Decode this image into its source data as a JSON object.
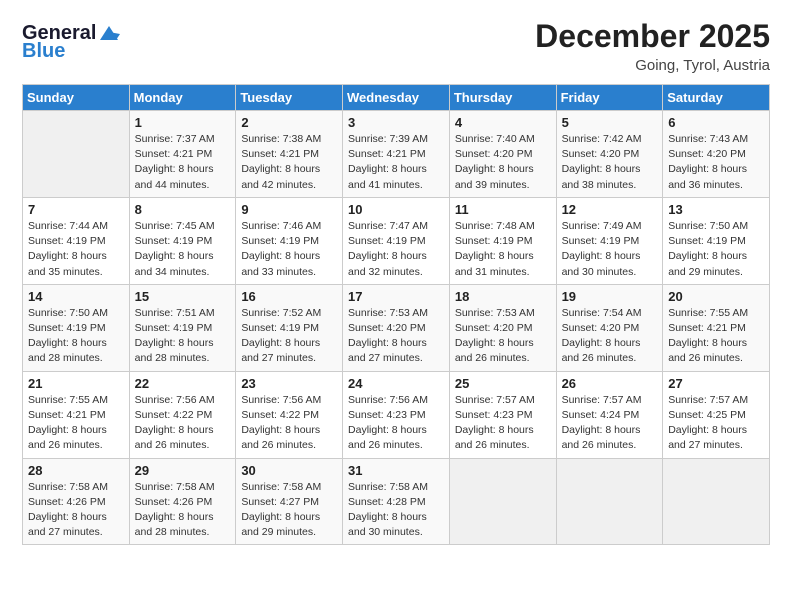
{
  "header": {
    "logo_line1": "General",
    "logo_line2": "Blue",
    "month": "December 2025",
    "location": "Going, Tyrol, Austria"
  },
  "weekdays": [
    "Sunday",
    "Monday",
    "Tuesday",
    "Wednesday",
    "Thursday",
    "Friday",
    "Saturday"
  ],
  "weeks": [
    [
      {
        "day": "",
        "info": ""
      },
      {
        "day": "1",
        "info": "Sunrise: 7:37 AM\nSunset: 4:21 PM\nDaylight: 8 hours\nand 44 minutes."
      },
      {
        "day": "2",
        "info": "Sunrise: 7:38 AM\nSunset: 4:21 PM\nDaylight: 8 hours\nand 42 minutes."
      },
      {
        "day": "3",
        "info": "Sunrise: 7:39 AM\nSunset: 4:21 PM\nDaylight: 8 hours\nand 41 minutes."
      },
      {
        "day": "4",
        "info": "Sunrise: 7:40 AM\nSunset: 4:20 PM\nDaylight: 8 hours\nand 39 minutes."
      },
      {
        "day": "5",
        "info": "Sunrise: 7:42 AM\nSunset: 4:20 PM\nDaylight: 8 hours\nand 38 minutes."
      },
      {
        "day": "6",
        "info": "Sunrise: 7:43 AM\nSunset: 4:20 PM\nDaylight: 8 hours\nand 36 minutes."
      }
    ],
    [
      {
        "day": "7",
        "info": "Sunrise: 7:44 AM\nSunset: 4:19 PM\nDaylight: 8 hours\nand 35 minutes."
      },
      {
        "day": "8",
        "info": "Sunrise: 7:45 AM\nSunset: 4:19 PM\nDaylight: 8 hours\nand 34 minutes."
      },
      {
        "day": "9",
        "info": "Sunrise: 7:46 AM\nSunset: 4:19 PM\nDaylight: 8 hours\nand 33 minutes."
      },
      {
        "day": "10",
        "info": "Sunrise: 7:47 AM\nSunset: 4:19 PM\nDaylight: 8 hours\nand 32 minutes."
      },
      {
        "day": "11",
        "info": "Sunrise: 7:48 AM\nSunset: 4:19 PM\nDaylight: 8 hours\nand 31 minutes."
      },
      {
        "day": "12",
        "info": "Sunrise: 7:49 AM\nSunset: 4:19 PM\nDaylight: 8 hours\nand 30 minutes."
      },
      {
        "day": "13",
        "info": "Sunrise: 7:50 AM\nSunset: 4:19 PM\nDaylight: 8 hours\nand 29 minutes."
      }
    ],
    [
      {
        "day": "14",
        "info": "Sunrise: 7:50 AM\nSunset: 4:19 PM\nDaylight: 8 hours\nand 28 minutes."
      },
      {
        "day": "15",
        "info": "Sunrise: 7:51 AM\nSunset: 4:19 PM\nDaylight: 8 hours\nand 28 minutes."
      },
      {
        "day": "16",
        "info": "Sunrise: 7:52 AM\nSunset: 4:19 PM\nDaylight: 8 hours\nand 27 minutes."
      },
      {
        "day": "17",
        "info": "Sunrise: 7:53 AM\nSunset: 4:20 PM\nDaylight: 8 hours\nand 27 minutes."
      },
      {
        "day": "18",
        "info": "Sunrise: 7:53 AM\nSunset: 4:20 PM\nDaylight: 8 hours\nand 26 minutes."
      },
      {
        "day": "19",
        "info": "Sunrise: 7:54 AM\nSunset: 4:20 PM\nDaylight: 8 hours\nand 26 minutes."
      },
      {
        "day": "20",
        "info": "Sunrise: 7:55 AM\nSunset: 4:21 PM\nDaylight: 8 hours\nand 26 minutes."
      }
    ],
    [
      {
        "day": "21",
        "info": "Sunrise: 7:55 AM\nSunset: 4:21 PM\nDaylight: 8 hours\nand 26 minutes."
      },
      {
        "day": "22",
        "info": "Sunrise: 7:56 AM\nSunset: 4:22 PM\nDaylight: 8 hours\nand 26 minutes."
      },
      {
        "day": "23",
        "info": "Sunrise: 7:56 AM\nSunset: 4:22 PM\nDaylight: 8 hours\nand 26 minutes."
      },
      {
        "day": "24",
        "info": "Sunrise: 7:56 AM\nSunset: 4:23 PM\nDaylight: 8 hours\nand 26 minutes."
      },
      {
        "day": "25",
        "info": "Sunrise: 7:57 AM\nSunset: 4:23 PM\nDaylight: 8 hours\nand 26 minutes."
      },
      {
        "day": "26",
        "info": "Sunrise: 7:57 AM\nSunset: 4:24 PM\nDaylight: 8 hours\nand 26 minutes."
      },
      {
        "day": "27",
        "info": "Sunrise: 7:57 AM\nSunset: 4:25 PM\nDaylight: 8 hours\nand 27 minutes."
      }
    ],
    [
      {
        "day": "28",
        "info": "Sunrise: 7:58 AM\nSunset: 4:26 PM\nDaylight: 8 hours\nand 27 minutes."
      },
      {
        "day": "29",
        "info": "Sunrise: 7:58 AM\nSunset: 4:26 PM\nDaylight: 8 hours\nand 28 minutes."
      },
      {
        "day": "30",
        "info": "Sunrise: 7:58 AM\nSunset: 4:27 PM\nDaylight: 8 hours\nand 29 minutes."
      },
      {
        "day": "31",
        "info": "Sunrise: 7:58 AM\nSunset: 4:28 PM\nDaylight: 8 hours\nand 30 minutes."
      },
      {
        "day": "",
        "info": ""
      },
      {
        "day": "",
        "info": ""
      },
      {
        "day": "",
        "info": ""
      }
    ]
  ]
}
